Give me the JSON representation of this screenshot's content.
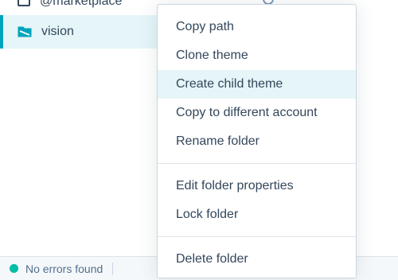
{
  "tree": {
    "partial_item_label": "@marketplace",
    "selected_item": {
      "label": "vision",
      "icon": "folder-icon"
    }
  },
  "context_menu": {
    "groups": [
      [
        "Copy path",
        "Clone theme",
        "Create child theme",
        "Copy to different account",
        "Rename folder"
      ],
      [
        "Edit folder properties",
        "Lock folder"
      ],
      [
        "Delete folder"
      ]
    ],
    "highlighted_item": "Create child theme"
  },
  "status_bar": {
    "text": "No errors found",
    "status_color": "#00bda5"
  },
  "colors": {
    "accent": "#00a4bd",
    "selected_bg": "#e5f5f8",
    "text": "#33475b"
  }
}
